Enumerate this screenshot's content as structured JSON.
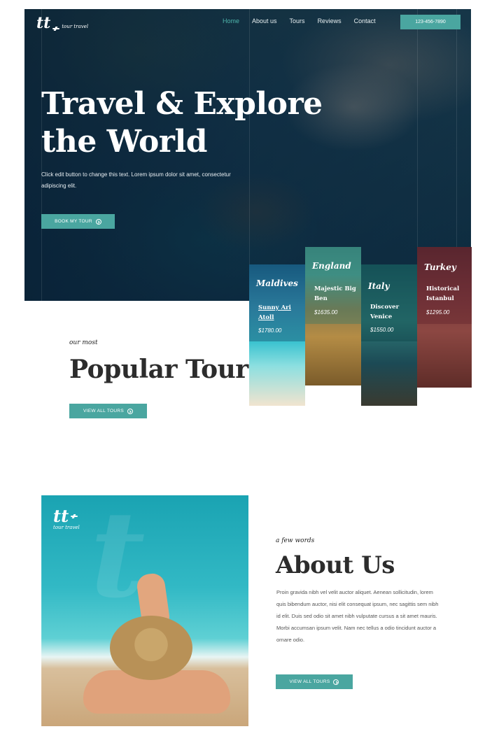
{
  "header": {
    "logo_mark": "tt",
    "logo_tagline": "tour travel",
    "nav": [
      "Home",
      "About us",
      "Tours",
      "Reviews",
      "Contact"
    ],
    "active_nav": "Home",
    "phone": "123-456-7890"
  },
  "hero": {
    "title_line1": "Travel & Explore",
    "title_line2": "the World",
    "subtitle": "Click edit button to change this text. Lorem ipsum dolor sit amet, consectetur adipiscing elit.",
    "button": "BOOK MY TOUR"
  },
  "tours": [
    {
      "country": "Maldives",
      "name": "Sunny Ari Atoll",
      "price": "$1780.00"
    },
    {
      "country": "England",
      "name": "Majestic Big Ben",
      "price": "$1635.00"
    },
    {
      "country": "Italy",
      "name": "Discover Venice",
      "price": "$1550.00"
    },
    {
      "country": "Turkey",
      "name": "Historical Istanbul",
      "price": "$1295.00"
    }
  ],
  "popular": {
    "kicker": "our most",
    "heading": "Popular Tours",
    "button": "VIEW ALL TOURS"
  },
  "about": {
    "kicker": "a few words",
    "heading": "About Us",
    "body": "Proin gravida nibh vel velit auctor aliquet. Aenean sollicitudin, lorem quis bibendum auctor, nisi elit consequat ipsum, nec sagittis sem nibh id elit. Duis sed odio sit amet nibh vulputate cursus a sit amet mauris. Morbi accumsan ipsum velit. Nam nec tellus a odio tincidunt auctor a ornare odio.",
    "button": "VIEW ALL TOURS",
    "photo_logo_mark": "tt",
    "photo_logo_tagline": "tour travel",
    "photo_watermark": "t"
  },
  "colors": {
    "accent": "#4aa6a0",
    "hero_overlay": "#082a45",
    "heading": "#2c2c2c"
  }
}
